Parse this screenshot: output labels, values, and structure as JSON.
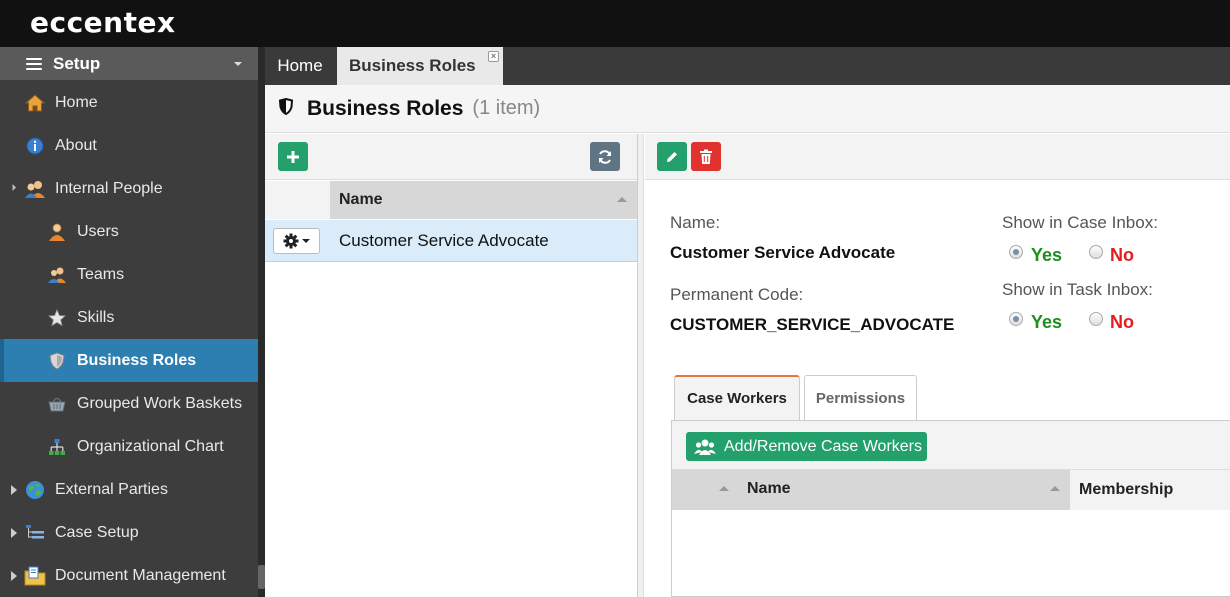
{
  "app": {
    "brand": "eccentex"
  },
  "sidebar": {
    "header": "Setup",
    "items": [
      {
        "label": "Home",
        "icon": "home-icon"
      },
      {
        "label": "About",
        "icon": "info-icon"
      },
      {
        "label": "Internal People",
        "icon": "people-icon"
      },
      {
        "label": "Users",
        "icon": "user-icon"
      },
      {
        "label": "Teams",
        "icon": "team-icon"
      },
      {
        "label": "Skills",
        "icon": "star-icon"
      },
      {
        "label": "Business Roles",
        "icon": "shield-icon"
      },
      {
        "label": "Grouped Work Baskets",
        "icon": "basket-icon"
      },
      {
        "label": "Organizational Chart",
        "icon": "org-chart-icon"
      },
      {
        "label": "External Parties",
        "icon": "globe-icon"
      },
      {
        "label": "Case Setup",
        "icon": "tree-icon"
      },
      {
        "label": "Document Management",
        "icon": "folder-icon"
      }
    ]
  },
  "tabs": [
    {
      "label": "Home"
    },
    {
      "label": "Business Roles"
    }
  ],
  "page": {
    "title": "Business Roles",
    "count": "(1 item)"
  },
  "list": {
    "column_name": "Name",
    "rows": [
      {
        "name": "Customer Service Advocate"
      }
    ]
  },
  "detail": {
    "name_label": "Name:",
    "name_value": "Customer Service Advocate",
    "code_label": "Permanent Code:",
    "code_value": "CUSTOMER_SERVICE_ADVOCATE",
    "case_inbox_label": "Show in Case Inbox:",
    "task_inbox_label": "Show in Task Inbox:",
    "yes_label": "Yes",
    "no_label": "No",
    "case_inbox_value": "Yes",
    "task_inbox_value": "Yes",
    "tabs": [
      {
        "label": "Case Workers"
      },
      {
        "label": "Permissions"
      }
    ],
    "add_button": "Add/Remove Case Workers",
    "columns": [
      "Name",
      "Membership"
    ]
  },
  "colors": {
    "accent": "#2e7fb1",
    "green": "#23a06b",
    "red": "#e0322e",
    "yes": "#1e8f1e",
    "no": "#e41c1c"
  }
}
